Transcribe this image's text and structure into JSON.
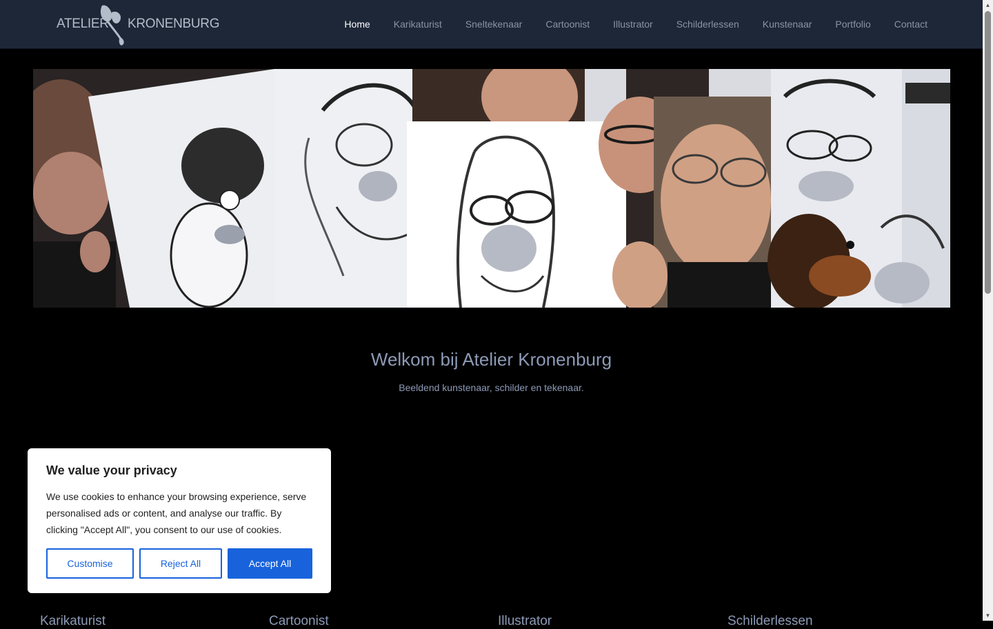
{
  "header": {
    "logo": {
      "left_text": "ATELIER",
      "right_text": "KRONENBURG"
    },
    "nav": [
      {
        "label": "Home",
        "active": true
      },
      {
        "label": "Karikaturist",
        "active": false
      },
      {
        "label": "Sneltekenaar",
        "active": false
      },
      {
        "label": "Cartoonist",
        "active": false
      },
      {
        "label": "Illustrator",
        "active": false
      },
      {
        "label": "Schilderlessen",
        "active": false
      },
      {
        "label": "Kunstenaar",
        "active": false
      },
      {
        "label": "Portfolio",
        "active": false
      },
      {
        "label": "Contact",
        "active": false
      }
    ]
  },
  "hero": {
    "image": "caricature-collage"
  },
  "main": {
    "welcome_title": "Welkom bij Atelier Kronenburg",
    "subtitle": "Beeldend kunstenaar, schilder en tekenaar."
  },
  "sections": {
    "headings": [
      "Karikaturist",
      "Cartoonist",
      "Illustrator",
      "Schilderlessen"
    ]
  },
  "cookie_banner": {
    "title": "We value your privacy",
    "text": "We use cookies to enhance your browsing experience, serve personalised ads or content, and analyse our traffic. By clicking \"Accept All\", you consent to our use of cookies.",
    "customise_label": "Customise",
    "reject_label": "Reject All",
    "accept_label": "Accept All"
  },
  "colors": {
    "header_bg": "#1d2738",
    "accent_blue": "#1863dc",
    "heading_text": "#8d9ab6"
  }
}
